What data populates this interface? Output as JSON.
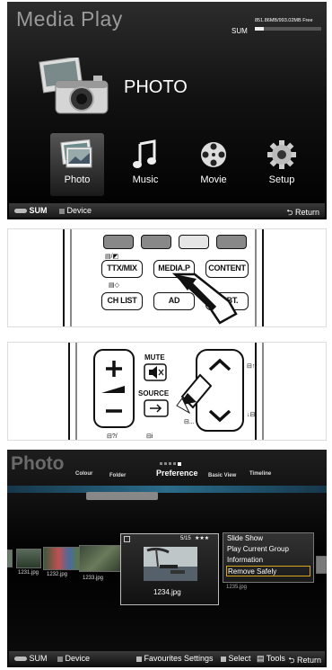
{
  "media_menu": {
    "title": "Media Play",
    "sum_label": "SUM",
    "memory_text": "851.86MB/993.02MB Free",
    "memory_used_fraction": 0.14,
    "category_title": "PHOTO",
    "items": [
      {
        "label": "Photo",
        "icon": "photo-icon"
      },
      {
        "label": "Music",
        "icon": "music-note-icon"
      },
      {
        "label": "Movie",
        "icon": "film-reel-icon"
      },
      {
        "label": "Setup",
        "icon": "gear-icon"
      }
    ],
    "footer": {
      "sum": "SUM",
      "device": "Device",
      "return": "Return"
    }
  },
  "remote_top": {
    "colors": [
      "#888888",
      "#888888",
      "#e5e5e5",
      "#888888"
    ],
    "buttons": [
      "TTX/MIX",
      "MEDIA.P",
      "CONTENT",
      "CH LIST",
      "AD",
      "SUBT."
    ]
  },
  "remote_bottom": {
    "mute": "MUTE",
    "source": "SOURCE"
  },
  "photo_browser": {
    "title": "Photo",
    "tabs": [
      "Colour",
      "Folder",
      "Preference",
      "Basic View",
      "Timeline"
    ],
    "active_tab": "Preference",
    "thumbnails": [
      "1231.jpg",
      "1232.jpg",
      "1233.jpg"
    ],
    "focused": {
      "name": "1234.jpg",
      "index": "5/15",
      "rating": "★★★"
    },
    "hidden_label": "1235.jpg",
    "context_menu": [
      "Slide Show",
      "Play Current Group",
      "Information",
      "Remove Safely"
    ],
    "footer": {
      "sum": "SUM",
      "device": "Device",
      "favourites": "Favourites Settings",
      "select": "Select",
      "tools": "Tools",
      "return": "Return"
    }
  },
  "colors": {
    "highlight": "#d7a41f",
    "blue_bar": "#2a6c8a"
  }
}
